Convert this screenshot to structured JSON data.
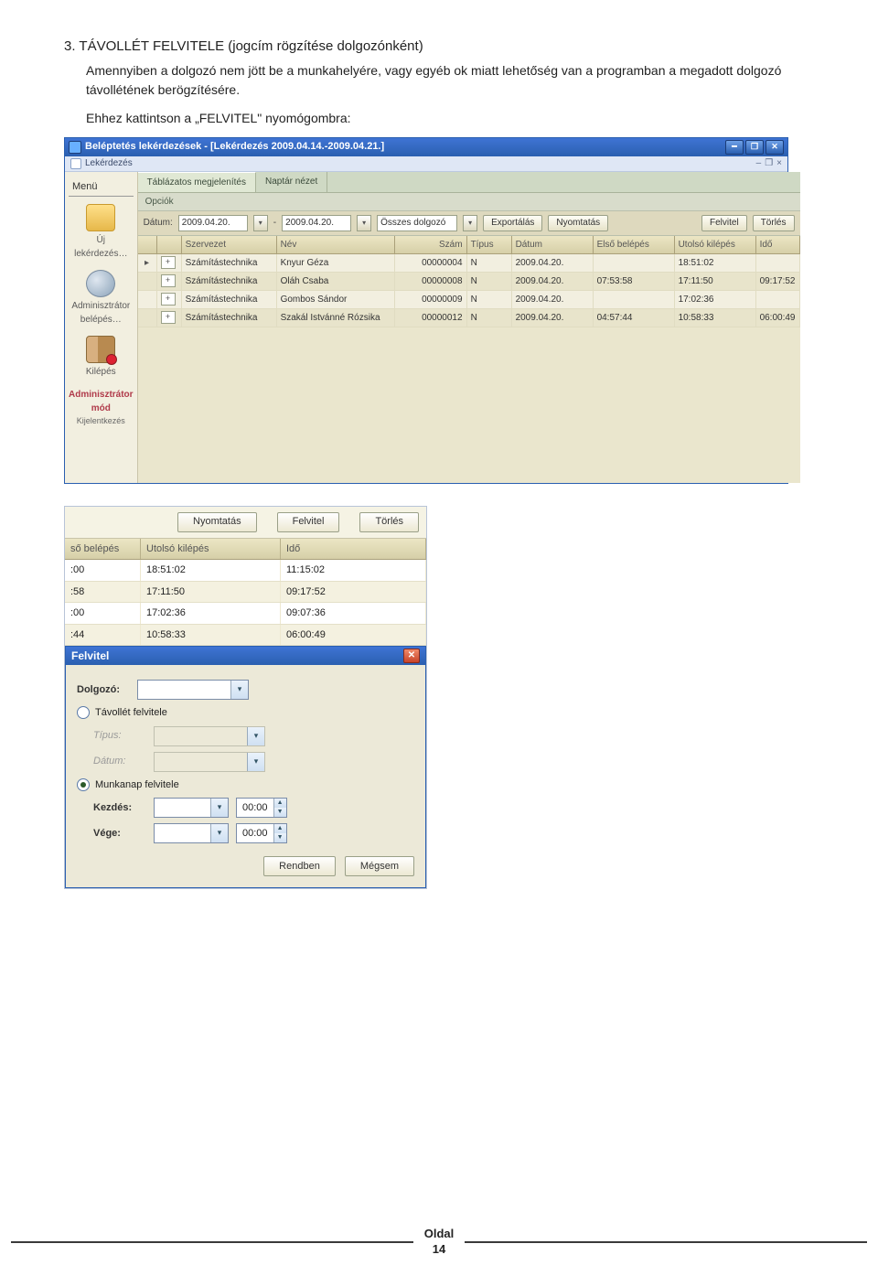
{
  "doc": {
    "heading": "3. TÁVOLLÉT FELVITELE (jogcím rögzítése dolgozónként)",
    "para1": "Amennyiben a dolgozó nem jött be a munkahelyére, vagy egyéb ok miatt lehetőség van a programban a megadott dolgozó távollétének berögzítésére.",
    "para2": "Ehhez kattintson a „FELVITEL\" nyomógombra:"
  },
  "app1": {
    "title": "Beléptetés lekérdezések - [Lekérdezés 2009.04.14.-2009.04.21.]",
    "submenu": "Lekérdezés",
    "menu_header": "Menü",
    "side": {
      "new_query": "Új lekérdezés…",
      "admin": "Adminisztrátor belépés…",
      "exit": "Kilépés",
      "admin_mode": "Adminisztrátor mód",
      "logout": "Kijelentkezés"
    },
    "tabs": {
      "tab1": "Táblázatos megjelenítés",
      "tab2": "Naptár nézet"
    },
    "opciok": "Opciók",
    "toolbar": {
      "date_label": "Dátum:",
      "date_from": "2009.04.20.",
      "date_to": "2009.04.20.",
      "all_emp": "Összes dolgozó",
      "export": "Exportálás",
      "print": "Nyomtatás",
      "felvitel": "Felvitel",
      "torles": "Törlés"
    },
    "cols": {
      "org": "Szervezet",
      "name": "Név",
      "num": "Szám",
      "type": "Típus",
      "date": "Dátum",
      "first": "Első belépés",
      "last": "Utolsó kilépés",
      "time": "Idő"
    },
    "rows": [
      {
        "org": "Számítástechnika",
        "name": "Knyur Géza",
        "num": "00000004",
        "type": "N",
        "date": "2009.04.20.",
        "first": "",
        "last": "18:51:02",
        "time": ""
      },
      {
        "org": "Számítástechnika",
        "name": "Oláh Csaba",
        "num": "00000008",
        "type": "N",
        "date": "2009.04.20.",
        "first": "07:53:58",
        "last": "17:11:50",
        "time": "09:17:52"
      },
      {
        "org": "Számítástechnika",
        "name": "Gombos Sándor",
        "num": "00000009",
        "type": "N",
        "date": "2009.04.20.",
        "first": "",
        "last": "17:02:36",
        "time": ""
      },
      {
        "org": "Számítástechnika",
        "name": "Szakál Istvánné Rózsika",
        "num": "00000012",
        "type": "N",
        "date": "2009.04.20.",
        "first": "04:57:44",
        "last": "10:58:33",
        "time": "06:00:49"
      }
    ]
  },
  "app2": {
    "toolbar": {
      "print": "Nyomtatás",
      "felvitel": "Felvitel",
      "torles": "Törlés"
    },
    "cols": {
      "first": "ső belépés",
      "last": "Utolsó kilépés",
      "time": "Idő"
    },
    "rows": [
      {
        "first": ":00",
        "last": "18:51:02",
        "time": "11:15:02"
      },
      {
        "first": ":58",
        "last": "17:11:50",
        "time": "09:17:52"
      },
      {
        "first": ":00",
        "last": "17:02:36",
        "time": "09:07:36"
      },
      {
        "first": ":44",
        "last": "10:58:33",
        "time": "06:00:49"
      }
    ]
  },
  "dlg": {
    "title": "Felvitel",
    "dolgozo_label": "Dolgozó:",
    "radio_tavollet": "Távollét felvitele",
    "tipus_label": "Típus:",
    "datum_label": "Dátum:",
    "radio_munkanap": "Munkanap felvitele",
    "kezdes_label": "Kezdés:",
    "vege_label": "Vége:",
    "time_value": "00:00",
    "ok": "Rendben",
    "cancel": "Mégsem"
  },
  "footer": {
    "oldal": "Oldal",
    "page": "14"
  }
}
